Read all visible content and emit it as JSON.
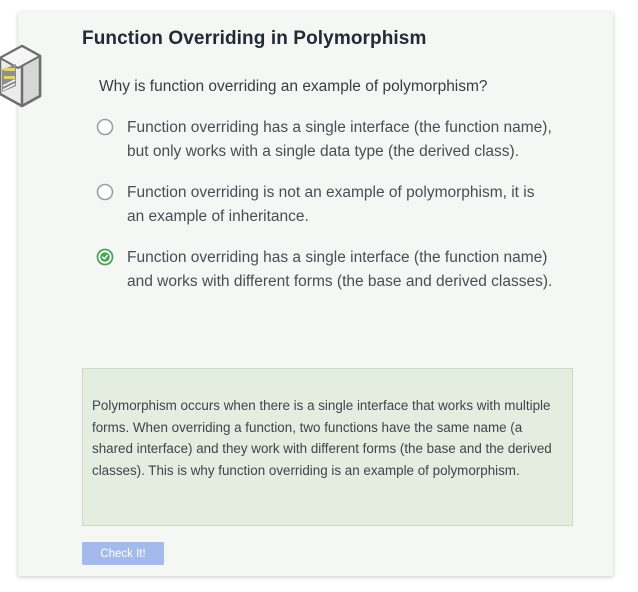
{
  "card": {
    "title": "Function Overriding in Polymorphism",
    "logo_icon": "multi-storey-building-icon"
  },
  "question": {
    "text": "Why is function overriding an example of polymorphism?",
    "options": [
      {
        "label": "Function overriding has a single interface (the function name), but only works with a single data type (the derived class).",
        "selected": false
      },
      {
        "label": "Function overriding is not an example of polymorphism, it is an example of inheritance.",
        "selected": false
      },
      {
        "label": "Function overriding has a single interface (the function name) and works with different forms (the base and derived classes).",
        "selected": true
      }
    ]
  },
  "feedback": {
    "text": "Polymorphism occurs when there is a single interface that works with multiple forms. When overriding a function, two functions have the same name (a shared interface) and they work with different forms (the base and the derived classes). This is why function overriding is an example of polymorphism."
  },
  "actions": {
    "check_label": "Check It!"
  },
  "colors": {
    "card_background": "#f4f7f3",
    "selected_green": "#4aa356",
    "radio_gray": "#9aa0a6",
    "feedback_background": "#e3eee1",
    "button_blue": "#a3baea"
  }
}
